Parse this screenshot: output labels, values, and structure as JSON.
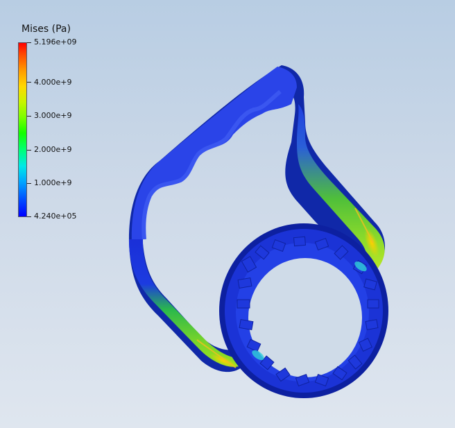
{
  "legend": {
    "title": "Mises (Pa)",
    "ticks": [
      "5.196e+09",
      "4.000e+9",
      "3.000e+9",
      "2.000e+9",
      "1.000e+9",
      "4.240e+05"
    ]
  },
  "colors": {
    "low": "#0000ff",
    "mid": "#13ff00",
    "high": "#ff0000",
    "background_top": "#b8cde3",
    "background_bottom": "#dfe6ef"
  }
}
